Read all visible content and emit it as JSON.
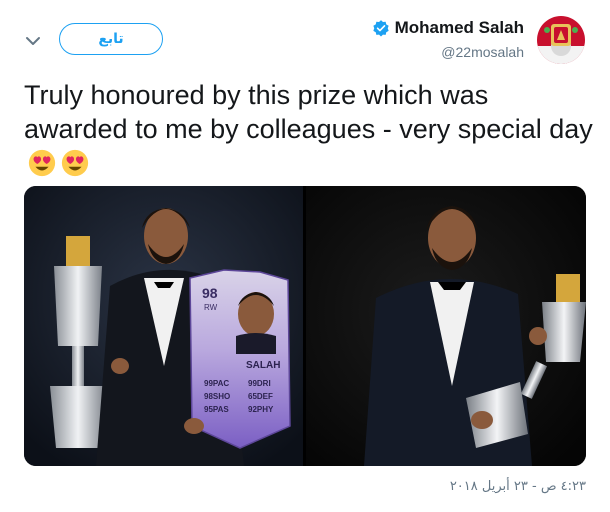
{
  "user": {
    "display_name": "Mohamed Salah",
    "handle": "@22mosalah",
    "verified": true,
    "avatar_icon": "liverpool-crest-avatar"
  },
  "follow_button": {
    "label": "تابع"
  },
  "menu": {
    "icon": "chevron-down-icon"
  },
  "tweet": {
    "text": "Truly honoured by this prize which was awarded to me by colleagues - very special day",
    "emojis": [
      "heart-eyes-emoji",
      "heart-eyes-emoji"
    ]
  },
  "media": {
    "card": {
      "rating": "98",
      "position": "RW",
      "name": "SALAH",
      "stats_left": [
        "99PAC",
        "98SHO",
        "95PAS"
      ],
      "stats_right": [
        "99DRI",
        "65DEF",
        "92PHY"
      ]
    }
  },
  "timestamp": "٤:٢٣ ص - ٢٣ أبريل ٢٠١٨",
  "colors": {
    "accent": "#1da1f2",
    "text": "#14171a",
    "muted": "#657786"
  }
}
